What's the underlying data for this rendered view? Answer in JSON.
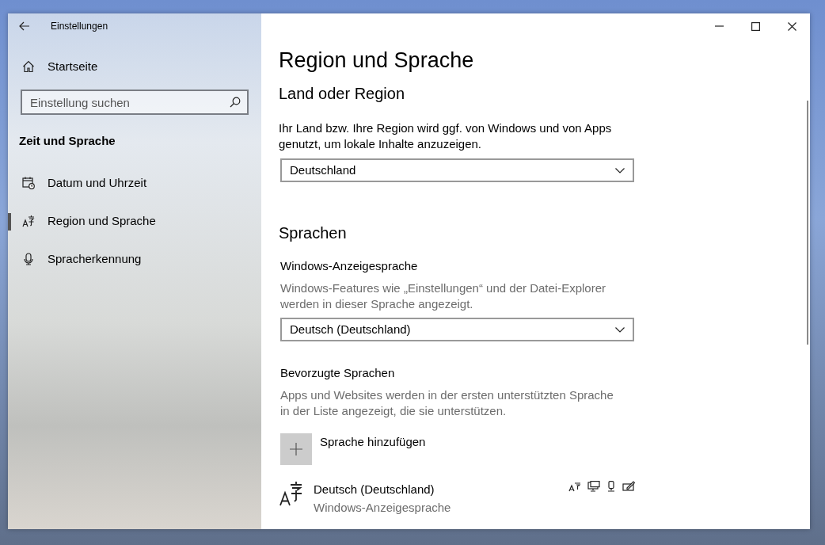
{
  "window": {
    "title": "Einstellungen"
  },
  "sidebar": {
    "home": "Startseite",
    "search": {
      "placeholder": "Einstellung suchen"
    },
    "section": "Zeit und Sprache",
    "items": [
      {
        "label": "Datum und Uhrzeit",
        "kind": "calendar",
        "selected": false
      },
      {
        "label": "Region und Sprache",
        "kind": "language",
        "selected": true
      },
      {
        "label": "Spracherkennung",
        "kind": "microphone",
        "selected": false
      }
    ]
  },
  "page": {
    "title": "Region und Sprache",
    "country": {
      "heading": "Land oder Region",
      "description": "Ihr Land bzw. Ihre Region wird ggf. von Windows und von Apps genutzt, um lokale Inhalte anzuzeigen.",
      "value": "Deutschland"
    },
    "languages": {
      "heading": "Sprachen",
      "display_label": "Windows-Anzeigesprache",
      "display_description": "Windows-Features wie „Einstellungen“ und der Datei-Explorer werden in dieser Sprache angezeigt.",
      "display_value": "Deutsch (Deutschland)",
      "preferred_label": "Bevorzugte Sprachen",
      "preferred_description": "Apps und Websites werden in der ersten unterstützten Sprache in der Liste angezeigt, die sie unterstützen.",
      "add_label": "Sprache hinzufügen",
      "list": [
        {
          "name": "Deutsch (Deutschland)",
          "detail": "Windows-Anzeigesprache"
        }
      ]
    }
  }
}
